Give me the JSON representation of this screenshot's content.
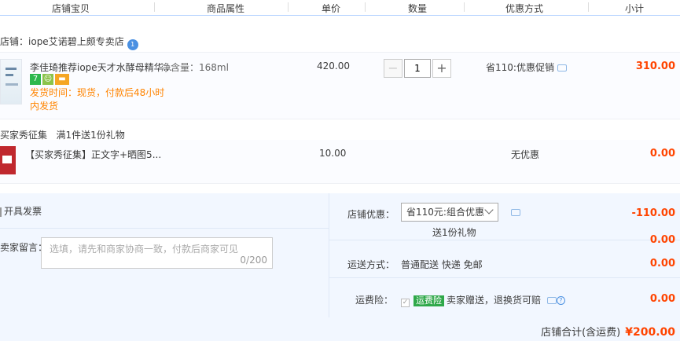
{
  "header": {
    "col_item": "店铺宝贝",
    "col_attr": "商品属性",
    "col_price": "单价",
    "col_qty": "数量",
    "col_promo": "优惠方式",
    "col_subtotal": "小计"
  },
  "shop": {
    "label": "店铺：",
    "name": "iope艾诺碧上颇专卖店",
    "badge": "1"
  },
  "items": [
    {
      "title": "李佳琦推荐iope天才水酵母精华...",
      "attr": "净含量：168ml",
      "ship_line1": "发货时间：现货，付款后48小时",
      "ship_line2": "内发货",
      "price": "420.00",
      "qty": "1",
      "promo": "省110:优惠促销",
      "subtotal": "310.00",
      "icons": [
        "7",
        "android-icon",
        "card-icon"
      ]
    },
    {
      "group_label": "买家秀征集",
      "group_desc": "满1件送1份礼物",
      "title": "【买家秀征集】正文字+晒图5...",
      "price": "10.00",
      "promo": "无优惠",
      "subtotal": "0.00"
    }
  ],
  "summary": {
    "invoice": "开具发票",
    "message_label": "卖家留言：",
    "message_placeholder": "选填，请先和商家协商一致，付款后商家可见",
    "message_count": "0/200",
    "discount_label": "店铺优惠：",
    "discount_selected": "省110元:组合优惠",
    "discount_gift": "送1份礼物",
    "discount_amount": "-110.00",
    "discount_extra": "0.00",
    "shipping_label": "运送方式：",
    "shipping_value": "普通配送 快递 免邮",
    "shipping_amount": "0.00",
    "insurance_label": "运费险：",
    "insurance_tag": "运费险",
    "insurance_text": "卖家赠送，退换货可赔",
    "insurance_amount": "0.00",
    "total_label": "店铺合计(含运费)",
    "total_amount": "¥200.00"
  },
  "colors": {
    "accent_red": "#ff4400",
    "ship_orange": "#ff8400",
    "panel_blue": "#f2f7ff"
  }
}
